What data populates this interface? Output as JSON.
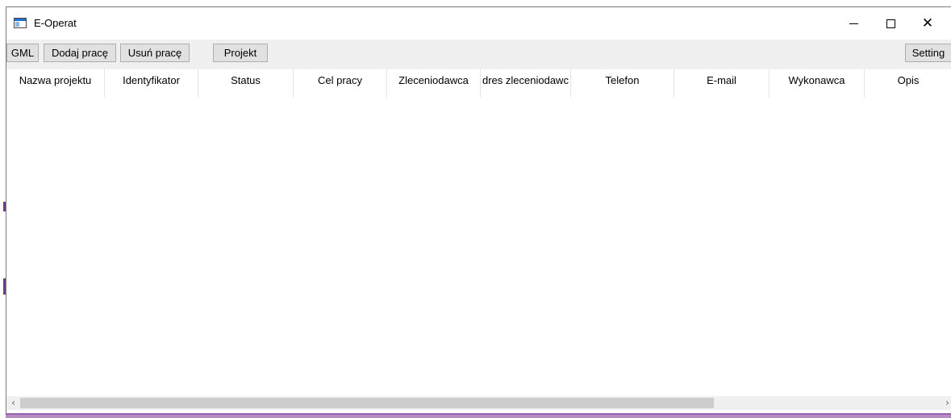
{
  "window": {
    "title": "E-Operat",
    "minimize_label": "–",
    "maximize_label": "□",
    "close_label": "✕"
  },
  "toolbar": {
    "gml_label": "GML",
    "add_work_label": "Dodaj pracę",
    "remove_work_label": "Usuń pracę",
    "project_label": "Projekt",
    "settings_label": "Setting"
  },
  "table": {
    "columns": [
      "Nazwa projektu",
      "Identyfikator",
      "Status",
      "Cel pracy",
      "Zleceniodawca",
      "dres zleceniodawc",
      "Telefon",
      "E-mail",
      "Wykonawca",
      "Opis"
    ],
    "rows": []
  },
  "scrollbar": {
    "left_arrow": "‹",
    "right_arrow": "›"
  },
  "colors": {
    "toolbar_bg": "#f0f0f0",
    "button_bg": "#e1e1e1",
    "button_border": "#adadad",
    "scroll_thumb": "#cdcdcd",
    "accent_bottom": "#9a5fae"
  }
}
